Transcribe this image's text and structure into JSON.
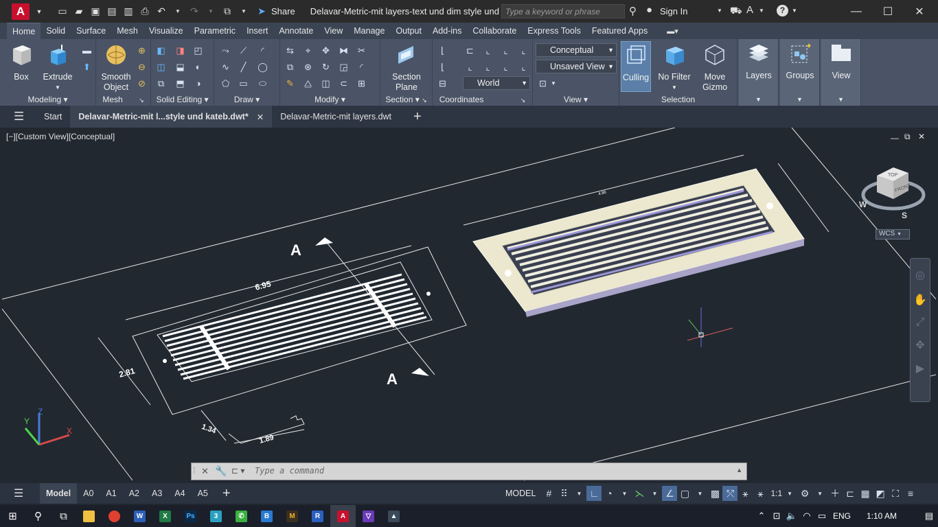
{
  "app": {
    "logo": "A",
    "title": "Delavar-Metric-mit layers-text und dim style und kat...",
    "share": "Share",
    "search_placeholder": "Type a keyword or phrase",
    "sign_in": "Sign In"
  },
  "ribbon_tabs": [
    "Home",
    "Solid",
    "Surface",
    "Mesh",
    "Visualize",
    "Parametric",
    "Insert",
    "Annotate",
    "View",
    "Manage",
    "Output",
    "Add-ins",
    "Collaborate",
    "Express Tools",
    "Featured Apps"
  ],
  "ribbon": {
    "box": "Box",
    "extrude": "Extrude",
    "smooth_object_1": "Smooth",
    "smooth_object_2": "Object",
    "section_plane_1": "Section",
    "section_plane_2": "Plane",
    "visual_style": "Conceptual",
    "saved_view": "Unsaved View",
    "ucs": "World",
    "culling": "Culling",
    "no_filter": "No Filter",
    "move_gizmo_1": "Move",
    "move_gizmo_2": "Gizmo",
    "layers": "Layers",
    "groups": "Groups",
    "view": "View",
    "panels": {
      "modeling": "Modeling",
      "mesh": "Mesh",
      "solid_editing": "Solid Editing",
      "draw": "Draw",
      "modify": "Modify",
      "section": "Section",
      "coordinates": "Coordinates",
      "view": "View",
      "selection": "Selection"
    }
  },
  "file_tabs": {
    "start": "Start",
    "active": "Delavar-Metric-mit l...style und kateb.dwt*",
    "other": "Delavar-Metric-mit layers.dwt"
  },
  "viewport": {
    "label": "[−][Custom View][Conceptual]",
    "viewcube_top": "TOP",
    "viewcube_front": "FRONT",
    "compass_w": "W",
    "compass_s": "S",
    "wcs": "WCS",
    "dim_width": "6.95",
    "dim_height": "2.81",
    "dim_detail_1": "1.34",
    "dim_detail_2": "1.89",
    "section_mark": "A",
    "dim_top_right": "4.86",
    "axis_x": "X",
    "axis_y": "Y",
    "axis_z": "Z"
  },
  "command": {
    "placeholder": "Type a command"
  },
  "layout_tabs": [
    "Model",
    "A0",
    "A1",
    "A2",
    "A3",
    "A4",
    "A5"
  ],
  "status": {
    "model": "MODEL",
    "scale": "1:1"
  },
  "taskbar": {
    "lang": "ENG",
    "time": "1:10 AM"
  },
  "colors": {
    "accent": "#c8102e",
    "viewport_bg": "#212830",
    "ribbon_bg": "#4a5466"
  }
}
